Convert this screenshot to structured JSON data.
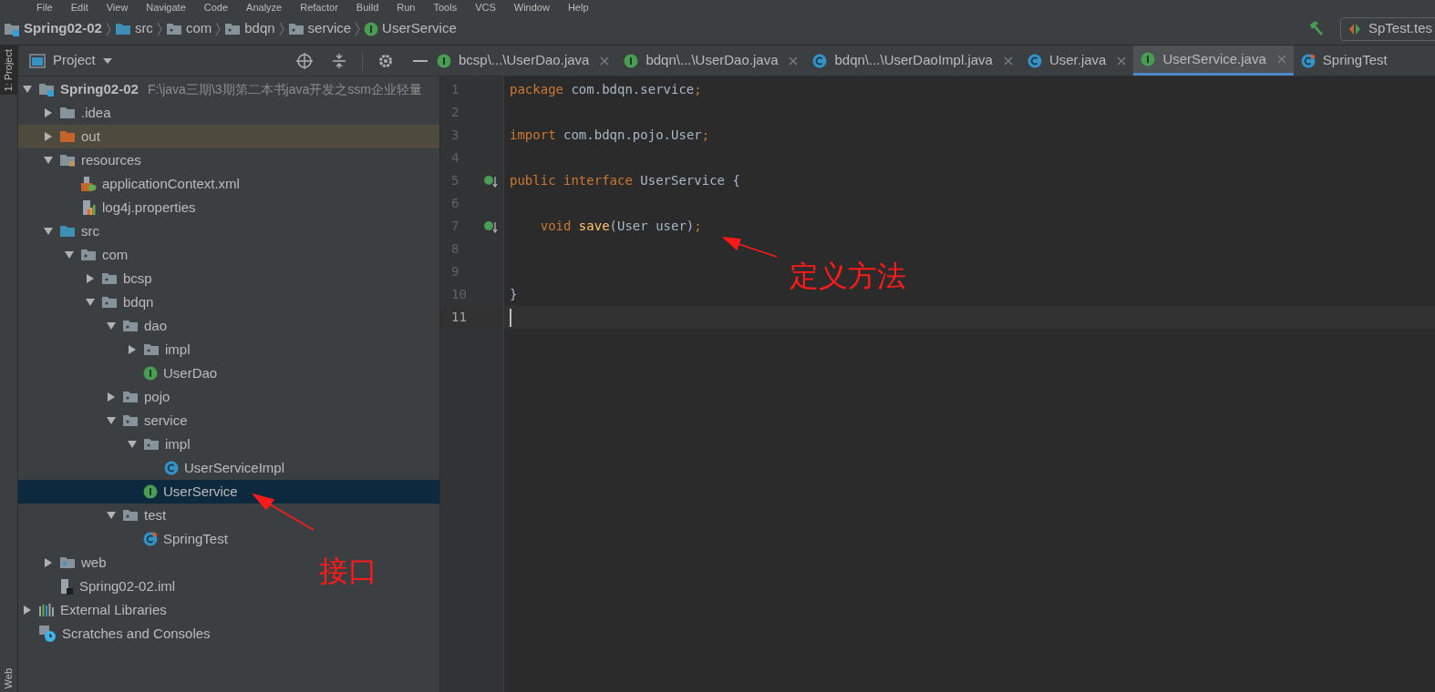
{
  "menu": [
    "File",
    "Edit",
    "View",
    "Navigate",
    "Code",
    "Analyze",
    "Refactor",
    "Build",
    "Run",
    "Tools",
    "VCS",
    "Window",
    "Help"
  ],
  "breadcrumbs": [
    {
      "label": "Spring02-02",
      "kind": "module"
    },
    {
      "label": "src",
      "kind": "source-folder"
    },
    {
      "label": "com",
      "kind": "package"
    },
    {
      "label": "bdqn",
      "kind": "package"
    },
    {
      "label": "service",
      "kind": "package"
    },
    {
      "label": "UserService",
      "kind": "interface"
    }
  ],
  "run_config": "SpTest.tes",
  "side_tabs": [
    {
      "label": "1: Project",
      "selected": true
    },
    {
      "label": "Web",
      "selected": false
    }
  ],
  "project_panel": {
    "title": "Project",
    "tree": [
      {
        "label": "Spring02-02",
        "path": "F:\\java三期\\3期第二本书java开发之ssm企业轻量",
        "kind": "module",
        "expanded": true,
        "selected": false,
        "children": [
          {
            "label": ".idea",
            "kind": "folder",
            "expanded": false,
            "selected": false
          },
          {
            "label": "out",
            "kind": "excluded-folder",
            "expanded": false,
            "selected": false
          },
          {
            "label": "resources",
            "kind": "resources-folder",
            "expanded": true,
            "selected": false,
            "children": [
              {
                "label": "applicationContext.xml",
                "kind": "xml",
                "selected": false
              },
              {
                "label": "log4j.properties",
                "kind": "properties",
                "selected": false
              }
            ]
          },
          {
            "label": "src",
            "kind": "source-folder",
            "expanded": true,
            "selected": false,
            "children": [
              {
                "label": "com",
                "kind": "package",
                "expanded": true,
                "selected": false,
                "children": [
                  {
                    "label": "bcsp",
                    "kind": "package",
                    "expanded": false,
                    "selected": false
                  },
                  {
                    "label": "bdqn",
                    "kind": "package",
                    "expanded": true,
                    "selected": false,
                    "children": [
                      {
                        "label": "dao",
                        "kind": "package",
                        "expanded": true,
                        "selected": false,
                        "children": [
                          {
                            "label": "impl",
                            "kind": "package",
                            "expanded": false,
                            "selected": false
                          },
                          {
                            "label": "UserDao",
                            "kind": "interface",
                            "selected": false
                          }
                        ]
                      },
                      {
                        "label": "pojo",
                        "kind": "package",
                        "expanded": false,
                        "selected": false
                      },
                      {
                        "label": "service",
                        "kind": "package",
                        "expanded": true,
                        "selected": false,
                        "children": [
                          {
                            "label": "impl",
                            "kind": "package",
                            "expanded": true,
                            "selected": false,
                            "children": [
                              {
                                "label": "UserServiceImpl",
                                "kind": "class",
                                "selected": false
                              }
                            ]
                          },
                          {
                            "label": "UserService",
                            "kind": "interface",
                            "selected": true
                          }
                        ]
                      },
                      {
                        "label": "test",
                        "kind": "package",
                        "expanded": true,
                        "selected": false,
                        "children": [
                          {
                            "label": "SpringTest",
                            "kind": "test-class",
                            "selected": false
                          }
                        ]
                      }
                    ]
                  }
                ]
              }
            ]
          },
          {
            "label": "web",
            "kind": "web-folder",
            "expanded": false,
            "selected": false
          },
          {
            "label": "Spring02-02.iml",
            "kind": "iml",
            "selected": false
          }
        ]
      },
      {
        "label": "External Libraries",
        "kind": "libraries",
        "expanded": false,
        "selected": false
      },
      {
        "label": "Scratches and Consoles",
        "kind": "scratches",
        "selected": false
      }
    ]
  },
  "tabs": [
    {
      "label": "bcsp\\...\\UserDao.java",
      "kind": "interface",
      "selected": false,
      "closable": true
    },
    {
      "label": "bdqn\\...\\UserDao.java",
      "kind": "interface",
      "selected": false,
      "closable": true
    },
    {
      "label": "bdqn\\...\\UserDaoImpl.java",
      "kind": "class",
      "selected": false,
      "closable": true
    },
    {
      "label": "User.java",
      "kind": "class",
      "selected": false,
      "closable": true
    },
    {
      "label": "UserService.java",
      "kind": "interface",
      "selected": true,
      "closable": true
    },
    {
      "label": "SpringTest",
      "kind": "test-class",
      "selected": false,
      "closable": false
    }
  ],
  "code": [
    {
      "number": "1",
      "implemented": false,
      "current": false,
      "tokens": [
        {
          "text": "package ",
          "kind": "keyword"
        },
        {
          "text": "com.bdqn.service",
          "kind": "plain"
        },
        {
          "text": ";",
          "kind": "keyword"
        }
      ]
    },
    {
      "number": "2",
      "implemented": false,
      "current": false
    },
    {
      "number": "3",
      "implemented": false,
      "current": false,
      "tokens": [
        {
          "text": "import ",
          "kind": "keyword"
        },
        {
          "text": "com.bdqn.pojo.User",
          "kind": "plain"
        },
        {
          "text": ";",
          "kind": "keyword"
        }
      ]
    },
    {
      "number": "4",
      "implemented": false,
      "current": false
    },
    {
      "number": "5",
      "implemented": true,
      "current": false,
      "tokens": [
        {
          "text": "public interface ",
          "kind": "keyword"
        },
        {
          "text": "UserService {",
          "kind": "plain"
        }
      ]
    },
    {
      "number": "6",
      "implemented": false,
      "current": false
    },
    {
      "number": "7",
      "implemented": true,
      "current": false,
      "tokens": [
        {
          "text": "    void ",
          "kind": "keyword"
        },
        {
          "text": "save",
          "kind": "method"
        },
        {
          "text": "(User user)",
          "kind": "plain"
        },
        {
          "text": ";",
          "kind": "keyword"
        }
      ]
    },
    {
      "number": "8",
      "implemented": false,
      "current": false
    },
    {
      "number": "9",
      "implemented": false,
      "current": false
    },
    {
      "number": "10",
      "implemented": false,
      "current": false,
      "tokens": [
        {
          "text": "}",
          "kind": "plain"
        }
      ]
    },
    {
      "number": "11",
      "implemented": false,
      "current": true
    }
  ],
  "annotations": [
    {
      "text": "接口"
    },
    {
      "text": "定义方法"
    }
  ]
}
